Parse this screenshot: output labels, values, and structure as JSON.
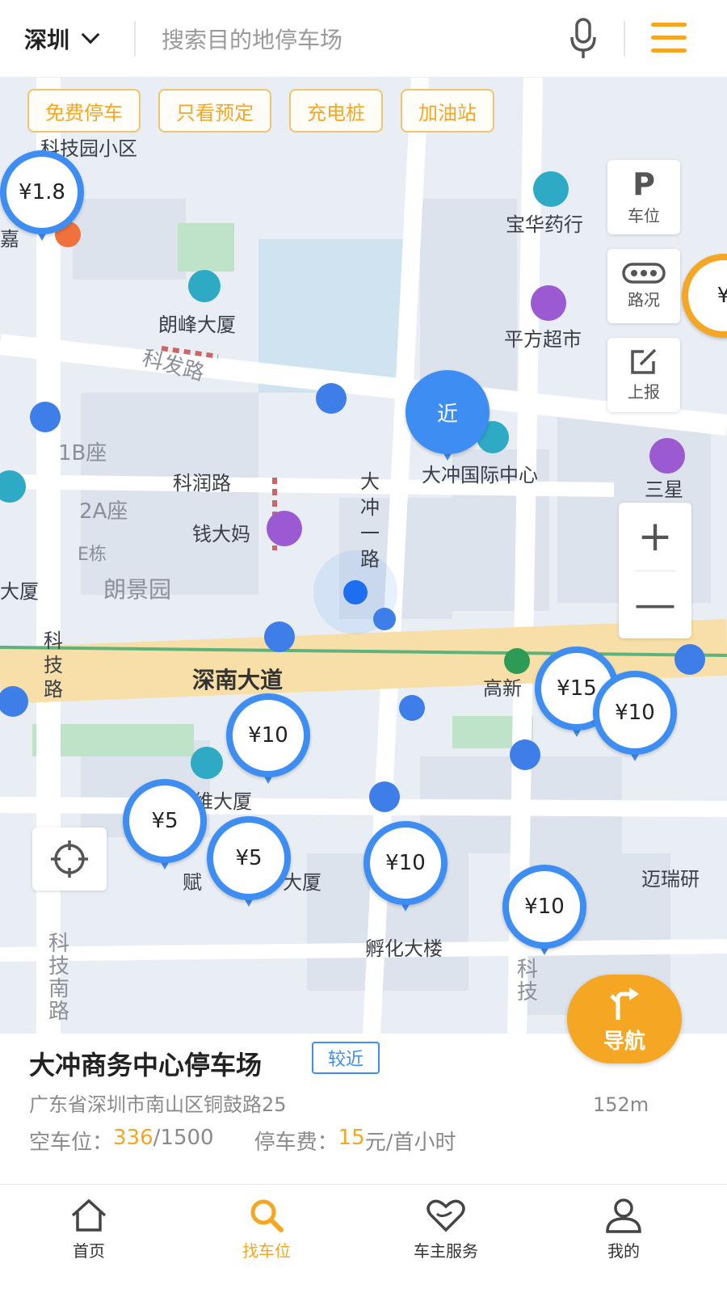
{
  "header": {
    "city": "深圳",
    "search_placeholder": "搜索目的地停车场"
  },
  "filters": [
    "免费停车",
    "只看预定",
    "充电桩",
    "加油站"
  ],
  "map_tools": {
    "parking": {
      "glyph": "P",
      "label": "车位"
    },
    "traffic": {
      "label": "路况"
    },
    "report": {
      "label": "上报"
    },
    "zoom_in": "+",
    "zoom_out": "—"
  },
  "map_labels": {
    "keji_yuan": "科技园小区",
    "jia": "嘉",
    "langfeng": "朗峰大厦",
    "kefa": "科发路",
    "b1": "1B座",
    "a2": "2A座",
    "e": "E栋",
    "dasha": "大厦",
    "langjing": "朗景园",
    "kerun": "科润路",
    "qiandama": "钱大妈",
    "dachong1": "大冲一路",
    "baohua": "宝华药行",
    "pingfang": "平方超市",
    "dachong_center": "大冲国际中心",
    "sanxing": "三星",
    "shennan": "深南大道",
    "gaoxin": "高新",
    "keji_road": "科技路",
    "weidasha": "维大厦",
    "fu": "赋",
    "dasha2": "大厦",
    "fuhua": "孵化大楼",
    "mairui": "迈瑞研",
    "keji_nan": "科技南路",
    "keji2": "科技"
  },
  "pins": [
    {
      "label": "¥1.8",
      "type": "price"
    },
    {
      "label": "近",
      "type": "near"
    },
    {
      "label": "¥10",
      "type": "price"
    },
    {
      "label": "¥15",
      "type": "price"
    },
    {
      "label": "¥10",
      "type": "price"
    },
    {
      "label": "¥5",
      "type": "price"
    },
    {
      "label": "¥5",
      "type": "price"
    },
    {
      "label": "¥10",
      "type": "price"
    },
    {
      "label": "¥10",
      "type": "price"
    },
    {
      "label": "¥",
      "type": "orange"
    }
  ],
  "navigate": {
    "label": "导航"
  },
  "lot": {
    "name": "大冲商务中心停车场",
    "tag": "较近",
    "distance": "152m",
    "address": "广东省深圳市南山区铜鼓路25",
    "spaces_label": "空车位：",
    "spaces_free": "336",
    "spaces_total": "/1500",
    "fee_label": "停车费：",
    "fee_value": "15",
    "fee_unit": "元/首小时"
  },
  "tabs": [
    {
      "label": "首页",
      "icon": "home-icon",
      "active": false
    },
    {
      "label": "找车位",
      "icon": "search-icon",
      "active": true
    },
    {
      "label": "车主服务",
      "icon": "heart-icon",
      "active": false
    },
    {
      "label": "我的",
      "icon": "user-icon",
      "active": false
    }
  ],
  "colors": {
    "accent": "#f5a623",
    "pin_blue": "#3d8df2",
    "map_bg": "#e9eef5"
  }
}
